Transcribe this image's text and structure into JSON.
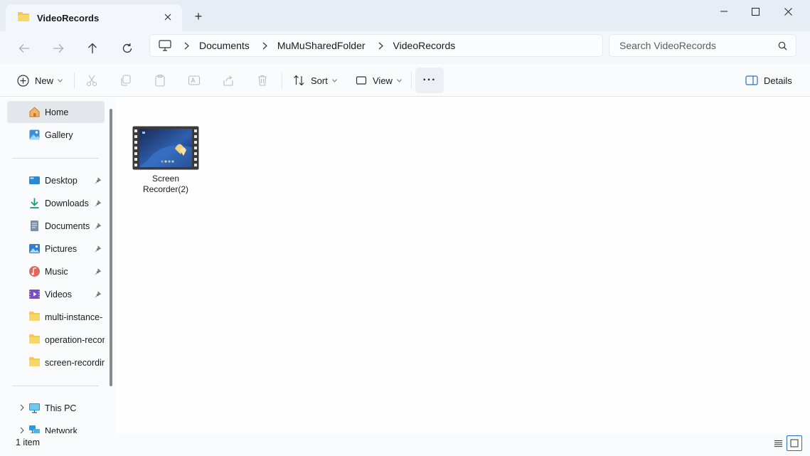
{
  "window": {
    "tab_title": "VideoRecords",
    "new_tab_symbol": "+"
  },
  "address": {
    "breadcrumbs": [
      "Documents",
      "MuMuSharedFolder",
      "VideoRecords"
    ],
    "search_placeholder": "Search VideoRecords"
  },
  "commands": {
    "new_label": "New",
    "sort_label": "Sort",
    "view_label": "View",
    "more_label": "···",
    "details_label": "Details"
  },
  "sidebar": {
    "items": [
      {
        "label": "Home",
        "icon": "home-icon"
      },
      {
        "label": "Gallery",
        "icon": "gallery-icon"
      },
      {
        "label": "Desktop",
        "icon": "desktop-icon"
      },
      {
        "label": "Downloads",
        "icon": "downloads-icon"
      },
      {
        "label": "Documents",
        "icon": "documents-icon"
      },
      {
        "label": "Pictures",
        "icon": "pictures-icon"
      },
      {
        "label": "Music",
        "icon": "music-icon"
      },
      {
        "label": "Videos",
        "icon": "videos-icon"
      },
      {
        "label": "multi-instance-",
        "icon": "folder-icon"
      },
      {
        "label": "operation-recor",
        "icon": "folder-icon"
      },
      {
        "label": "screen-recordin",
        "icon": "folder-icon"
      },
      {
        "label": "This PC",
        "icon": "this-pc-icon"
      },
      {
        "label": "Network",
        "icon": "network-icon"
      }
    ]
  },
  "content": {
    "files": [
      {
        "name": "Screen Recorder(2)",
        "type": "video"
      }
    ]
  },
  "status": {
    "item_count": "1 item"
  },
  "colors": {
    "accent": "#2a6fbf",
    "folder": "#f2c94c",
    "titlebar_bg": "#e7edf5"
  }
}
